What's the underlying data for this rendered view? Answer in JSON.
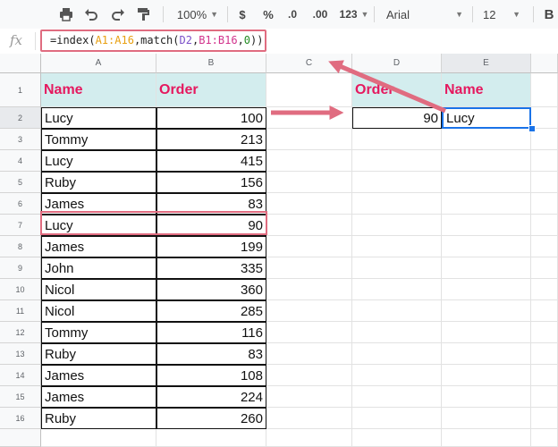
{
  "toolbar": {
    "print_icon": "print-icon",
    "undo_icon": "undo-icon",
    "redo_icon": "redo-icon",
    "paint_format_icon": "paint-format-icon",
    "zoom": "100%",
    "currency": "$",
    "percent": "%",
    "decrease_decimal": ".0",
    "increase_decimal": ".00",
    "more_formats": "123",
    "font": "Arial",
    "font_size": "12",
    "bold": "B"
  },
  "formula_bar": {
    "fx": "fx",
    "formula_parts": [
      {
        "text": "=index(",
        "color": "#222222"
      },
      {
        "text": "A1:A16",
        "color": "#e8a012"
      },
      {
        "text": ",match(",
        "color": "#222222"
      },
      {
        "text": "D2",
        "color": "#7b4fc9"
      },
      {
        "text": ",",
        "color": "#222222"
      },
      {
        "text": "B1:B16",
        "color": "#d2338c"
      },
      {
        "text": ",",
        "color": "#222222"
      },
      {
        "text": "0",
        "color": "#228b22"
      },
      {
        "text": "))",
        "color": "#222222"
      }
    ]
  },
  "columns": [
    "A",
    "B",
    "C",
    "D",
    "E"
  ],
  "selected_column": "E",
  "rows": [
    "1",
    "2",
    "3",
    "4",
    "5",
    "6",
    "7",
    "8",
    "9",
    "10",
    "11",
    "12",
    "13",
    "14",
    "15",
    "16",
    ""
  ],
  "selected_row": "2",
  "table": {
    "headers": [
      "Name",
      "Order"
    ],
    "data": [
      [
        "Lucy",
        "100"
      ],
      [
        "Tommy",
        "213"
      ],
      [
        "Lucy",
        "415"
      ],
      [
        "Ruby",
        "156"
      ],
      [
        "James",
        "83"
      ],
      [
        "Lucy",
        "90"
      ],
      [
        "James",
        "199"
      ],
      [
        "John",
        "335"
      ],
      [
        "Nicol",
        "360"
      ],
      [
        "Nicol",
        "285"
      ],
      [
        "Tommy",
        "116"
      ],
      [
        "Ruby",
        "83"
      ],
      [
        "James",
        "108"
      ],
      [
        "James",
        "224"
      ],
      [
        "Ruby",
        "260"
      ]
    ]
  },
  "lookup": {
    "order_header": "Order",
    "name_header": "Name",
    "order_value": "90",
    "name_value": "Lucy"
  },
  "colors": {
    "header_fill": "#d3edee",
    "header_text": "#e5195f",
    "annotation": "#e06c80",
    "selection": "#1a73e8"
  }
}
